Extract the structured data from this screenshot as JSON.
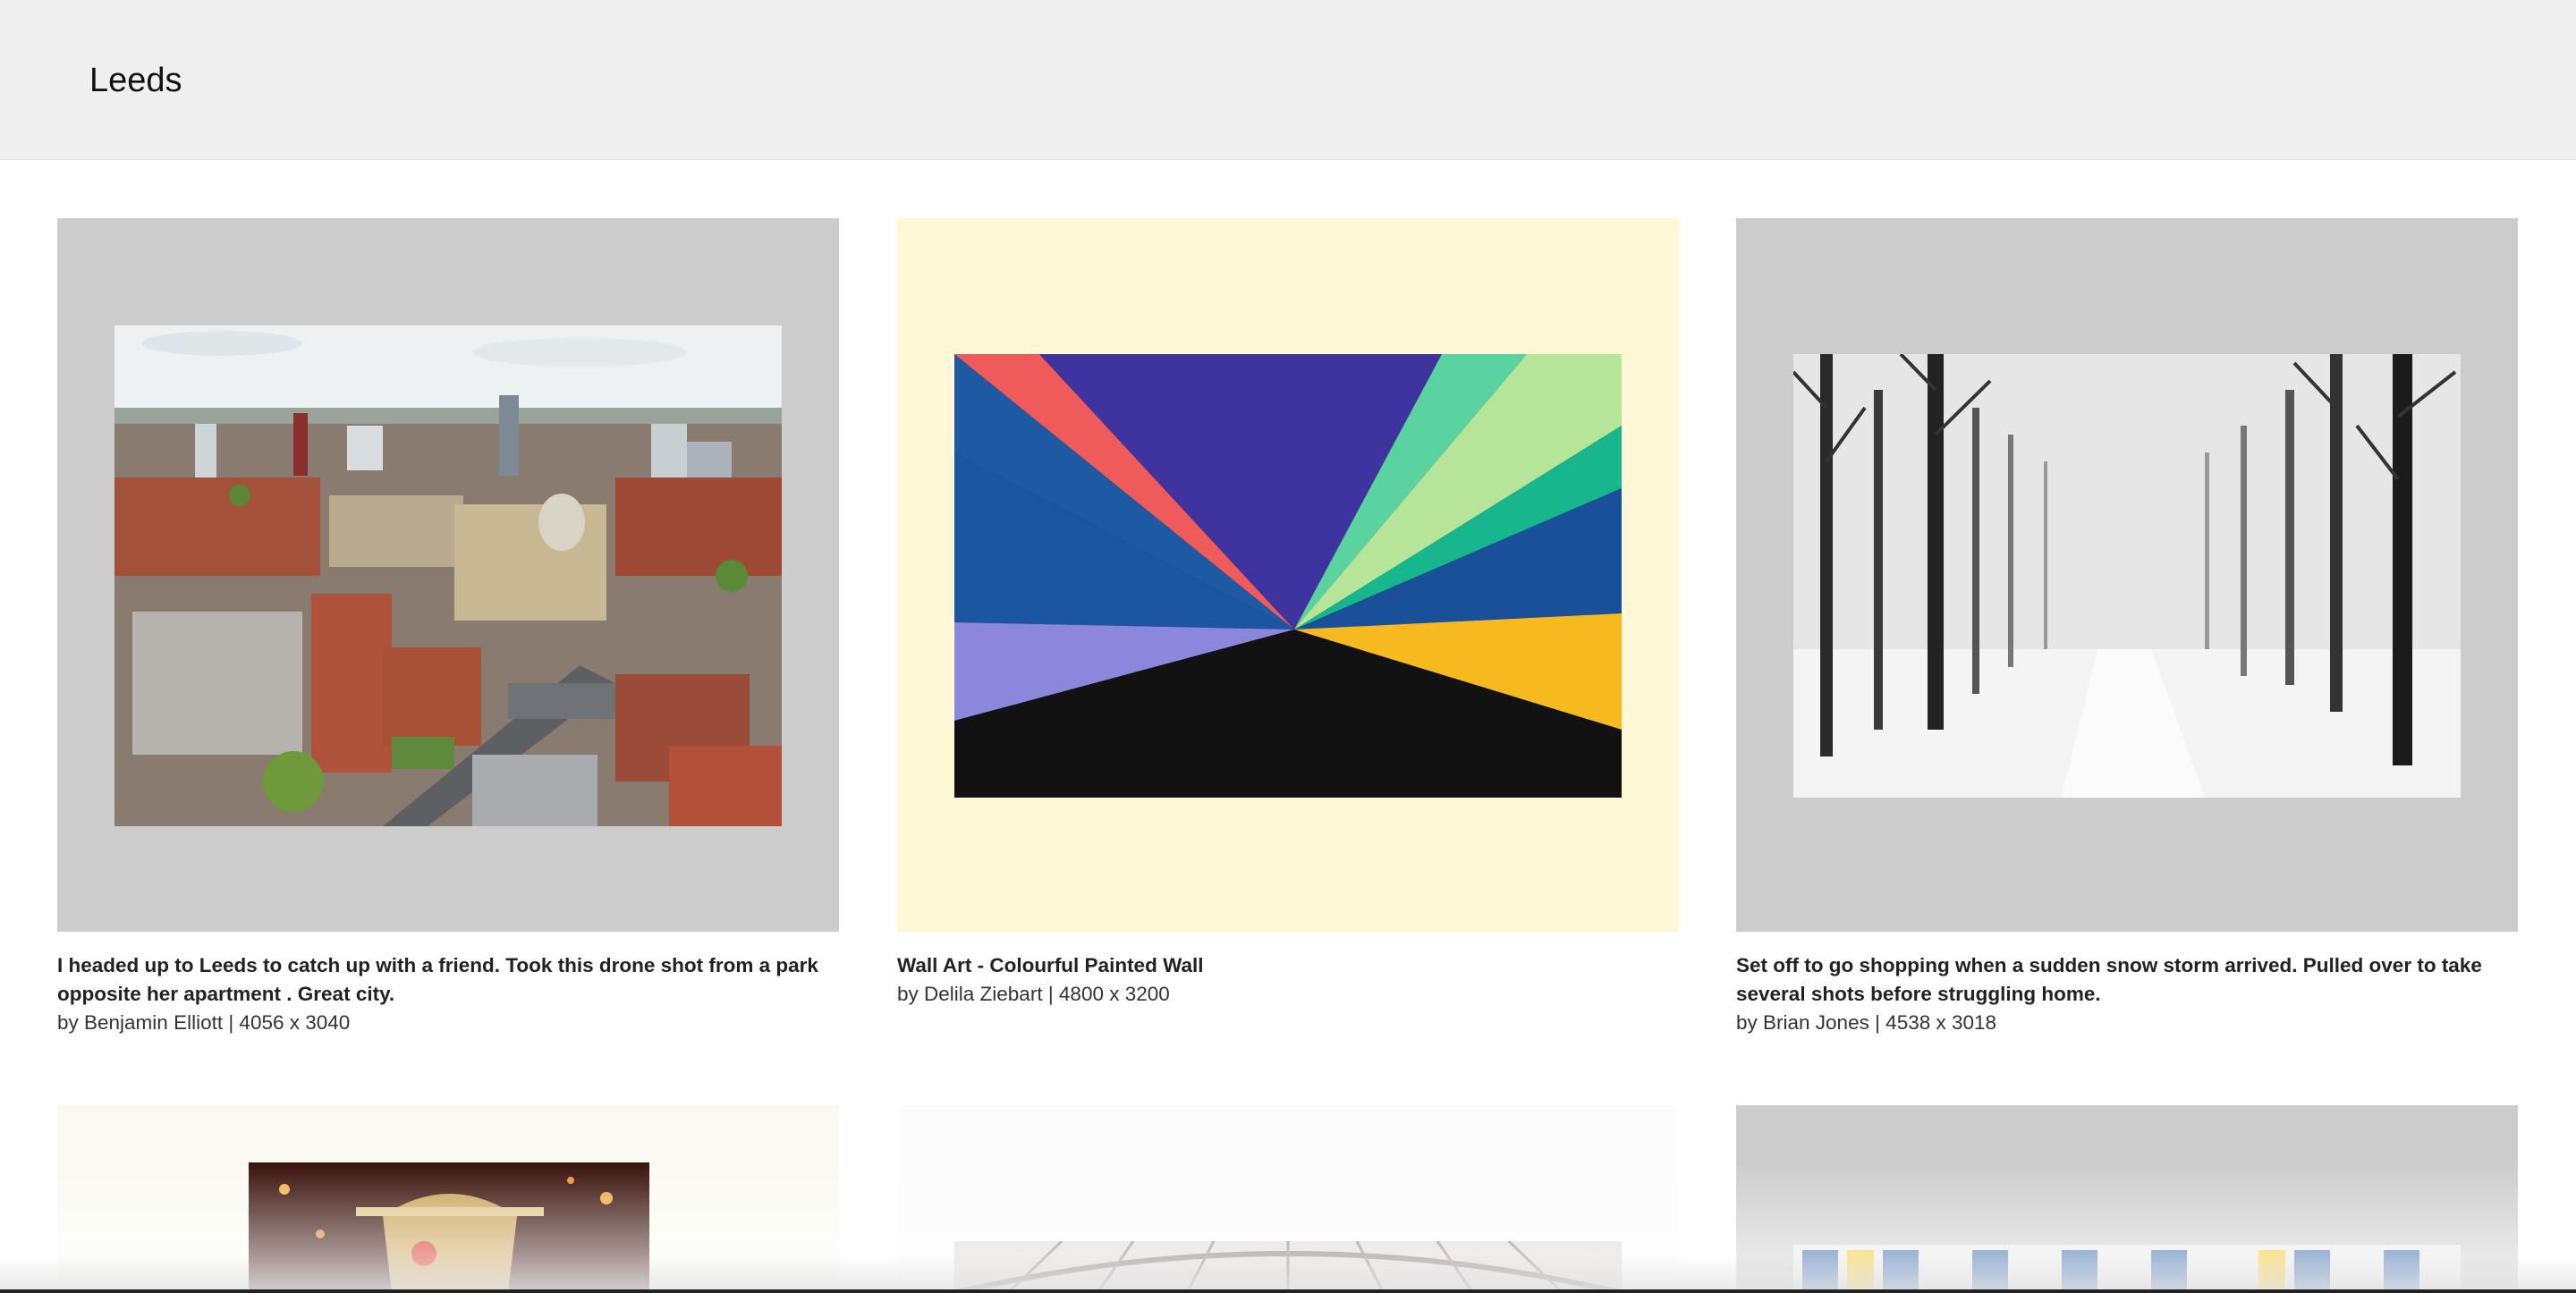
{
  "header": {
    "title": "Leeds"
  },
  "cards": [
    {
      "description": "I headed up to Leeds to catch up with a friend. Took this drone shot from a park opposite her apartment . Great city.",
      "meta": "by Benjamin Elliott | 4056 x 3040",
      "frame_color": "#cccccc",
      "icon": "city-aerial-photo"
    },
    {
      "description": "Wall Art - Colourful Painted Wall",
      "meta": "by Delila Ziebart | 4800 x 3200",
      "frame_color": "#fff8d6",
      "icon": "painted-wall-photo"
    },
    {
      "description": "Set off to go shopping when a sudden snow storm arrived. Pulled over to take several shots before struggling home.",
      "meta": "by Brian Jones | 4538 x 3018",
      "frame_color": "#cccccc",
      "icon": "snowy-trees-photo"
    },
    {
      "frame_color": "#fafaf2",
      "icon": "ornate-crown-photo"
    },
    {
      "frame_color": "#fbfbfb",
      "icon": "glass-arcade-photo"
    },
    {
      "frame_color": "#cccccc",
      "icon": "building-facade-photo"
    }
  ]
}
